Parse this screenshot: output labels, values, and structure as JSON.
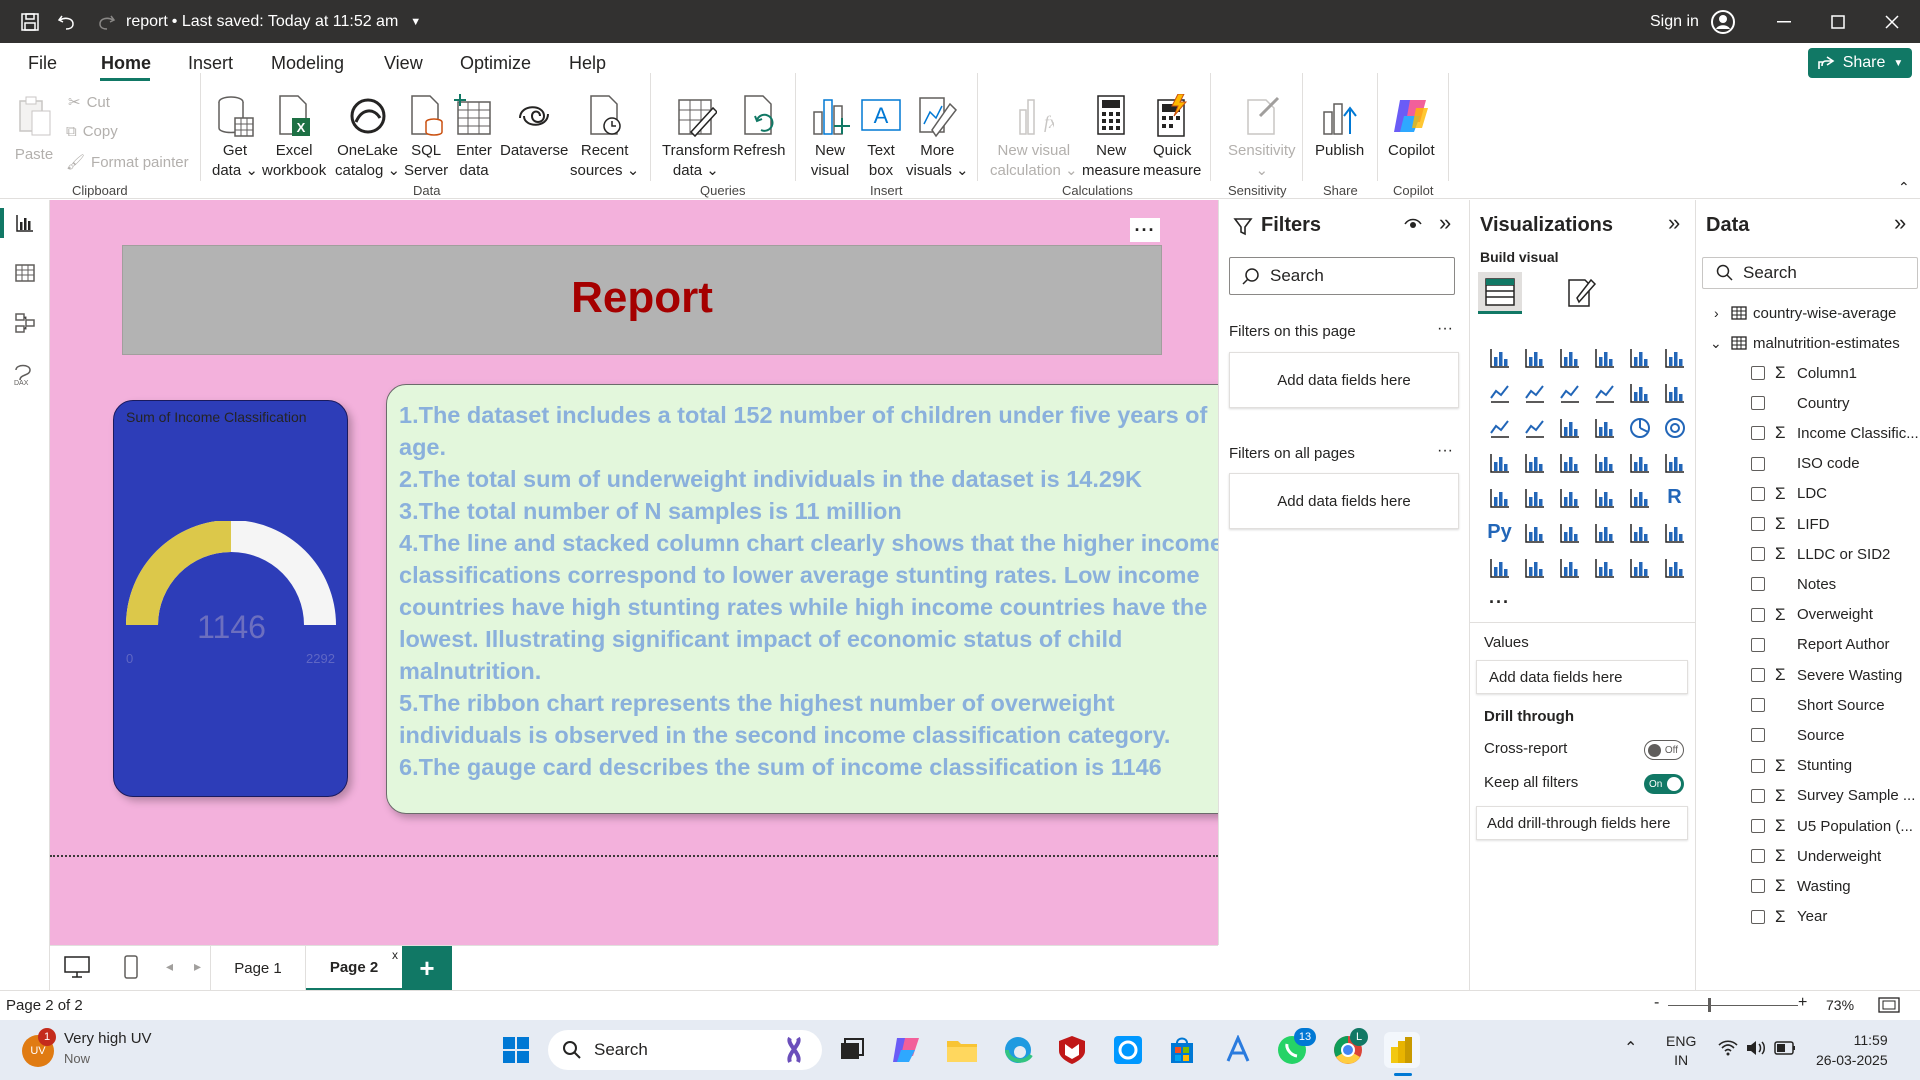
{
  "titlebar": {
    "file_name": "report",
    "saved_status": "• Last saved: Today at 11:52 am",
    "sign_in": "Sign in"
  },
  "menu": {
    "items": [
      "File",
      "Home",
      "Insert",
      "Modeling",
      "View",
      "Optimize",
      "Help"
    ],
    "share_label": "Share"
  },
  "ribbon": {
    "clipboard": {
      "paste": "Paste",
      "cut": "Cut",
      "copy": "Copy",
      "format_painter": "Format painter",
      "group": "Clipboard"
    },
    "data": {
      "get_data": [
        "Get",
        "data"
      ],
      "excel": [
        "Excel",
        "workbook"
      ],
      "onelake": [
        "OneLake",
        "catalog"
      ],
      "sql": [
        "SQL",
        "Server"
      ],
      "enter": [
        "Enter",
        "data"
      ],
      "dataverse": [
        "Dataverse",
        ""
      ],
      "recent": [
        "Recent",
        "sources"
      ],
      "group": "Data"
    },
    "queries": {
      "transform": [
        "Transform",
        "data"
      ],
      "refresh": [
        "Refresh",
        ""
      ],
      "group": "Queries"
    },
    "insert": {
      "new_visual": [
        "New",
        "visual"
      ],
      "text_box": [
        "Text",
        "box"
      ],
      "more_visuals": [
        "More",
        "visuals"
      ],
      "group": "Insert"
    },
    "calculations": {
      "new_visual_calc": [
        "New visual",
        "calculation"
      ],
      "new_measure": [
        "New",
        "measure"
      ],
      "quick_measure": [
        "Quick",
        "measure"
      ],
      "group": "Calculations"
    },
    "sensitivity": {
      "label": "Sensitivity",
      "group": "Sensitivity"
    },
    "share": {
      "publish": "Publish",
      "group": "Share"
    },
    "copilot": {
      "label": "Copilot",
      "group": "Copilot"
    }
  },
  "report": {
    "title": "Report",
    "gauge": {
      "title": "Sum of Income Classification",
      "value": "1146",
      "min": "0",
      "max": "2292",
      "fill_fraction": 0.5
    },
    "insights": [
      "1.The dataset includes  a total  152 number of children  under five years of age.",
      "2.The total sum of underweight individuals in the dataset is 14.29K",
      "3.The total number of N samples is 11 million",
      "4.The line and stacked column chart clearly shows that the higher income classifications correspond to lower average stunting rates. Low income countries have high stunting rates while high income countries have the lowest. Illustrating significant impact of economic status of child malnutrition.",
      "5.The ribbon chart represents the highest number of overweight individuals is observed in the second income classification category.",
      "6.The gauge card describes the sum of income classification is 1146"
    ]
  },
  "filters": {
    "title": "Filters",
    "search_placeholder": "Search",
    "this_page": "Filters on this page",
    "all_pages": "Filters on all pages",
    "add_fields": "Add data fields here"
  },
  "visualizations": {
    "title": "Visualizations",
    "build_visual": "Build visual",
    "values": "Values",
    "add_fields": "Add data fields here",
    "drill_through": "Drill through",
    "cross_report": "Cross-report",
    "cross_report_state": "Off",
    "keep_all_filters": "Keep all filters",
    "keep_all_state": "On",
    "add_drill": "Add drill-through fields here"
  },
  "data_pane": {
    "title": "Data",
    "search_placeholder": "Search",
    "tables": [
      "country-wise-average",
      "malnutrition-estimates"
    ],
    "fields": [
      {
        "name": "Column1",
        "sigma": true
      },
      {
        "name": "Country",
        "sigma": false
      },
      {
        "name": "Income Classific...",
        "sigma": true
      },
      {
        "name": "ISO code",
        "sigma": false
      },
      {
        "name": "LDC",
        "sigma": true
      },
      {
        "name": "LIFD",
        "sigma": true
      },
      {
        "name": "LLDC or SID2",
        "sigma": true
      },
      {
        "name": "Notes",
        "sigma": false
      },
      {
        "name": "Overweight",
        "sigma": true
      },
      {
        "name": "Report Author",
        "sigma": false
      },
      {
        "name": "Severe Wasting",
        "sigma": true
      },
      {
        "name": "Short Source",
        "sigma": false
      },
      {
        "name": "Source",
        "sigma": false
      },
      {
        "name": "Stunting",
        "sigma": true
      },
      {
        "name": "Survey Sample ...",
        "sigma": true
      },
      {
        "name": "U5 Population (...",
        "sigma": true
      },
      {
        "name": "Underweight",
        "sigma": true
      },
      {
        "name": "Wasting",
        "sigma": true
      },
      {
        "name": "Year",
        "sigma": true
      }
    ]
  },
  "pages": {
    "tabs": [
      "Page 1",
      "Page 2"
    ],
    "active": "Page 2",
    "close": "x",
    "add": "+"
  },
  "status": {
    "page_indicator": "Page 2 of 2",
    "zoom": "73%",
    "zoom_minus": "-",
    "zoom_plus": "+"
  },
  "taskbar": {
    "weather": "Very high UV",
    "weather_sub": "Now",
    "weather_badge": "1",
    "search": "Search",
    "lang": "ENG",
    "region": "IN",
    "time": "11:59",
    "date": "26-03-2025",
    "whatsapp_badge": "13",
    "chrome_badge": "L"
  }
}
